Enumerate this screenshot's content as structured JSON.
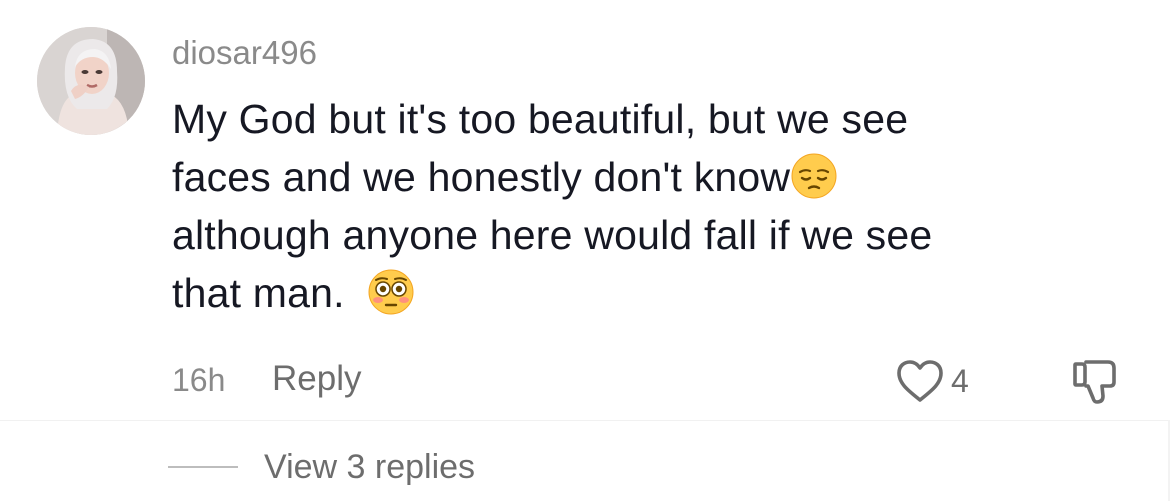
{
  "comment": {
    "username": "diosar496",
    "lines": [
      "My God but it's too beautiful, but we see",
      "faces and we honestly don't know",
      "although anyone here would fall if we see",
      "that man."
    ],
    "emojis": [
      "pensive-face-emoji",
      "flushed-face-emoji"
    ],
    "timestamp": "16h",
    "reply_label": "Reply",
    "like_count": "4",
    "view_replies_label": "View 3 replies"
  }
}
